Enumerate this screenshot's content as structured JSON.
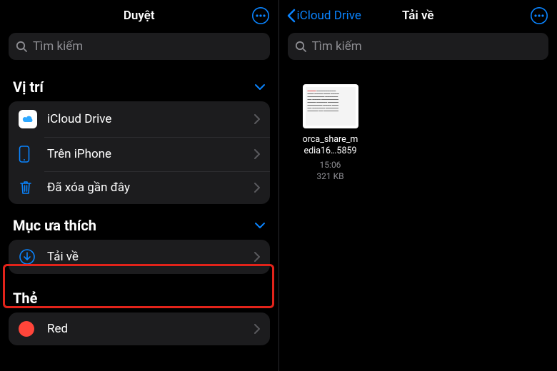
{
  "left": {
    "title": "Duyệt",
    "search_placeholder": "Tìm kiếm",
    "sections": {
      "locations": {
        "title": "Vị trí",
        "items": [
          {
            "label": "iCloud Drive"
          },
          {
            "label": "Trên iPhone"
          },
          {
            "label": "Đã xóa gần đây"
          }
        ]
      },
      "favorites": {
        "title": "Mục ưa thích",
        "items": [
          {
            "label": "Tải về"
          }
        ]
      },
      "tags": {
        "title": "Thẻ",
        "items": [
          {
            "label": "Red",
            "color": "#ff453a"
          }
        ]
      }
    }
  },
  "right": {
    "back_label": "iCloud Drive",
    "title": "Tải về",
    "search_placeholder": "Tìm kiếm",
    "files": [
      {
        "name_line1": "orca_share_m",
        "name_line2": "edia16…5859",
        "time": "15:06",
        "size": "321 KB"
      }
    ]
  },
  "colors": {
    "accent": "#0a84ff"
  }
}
